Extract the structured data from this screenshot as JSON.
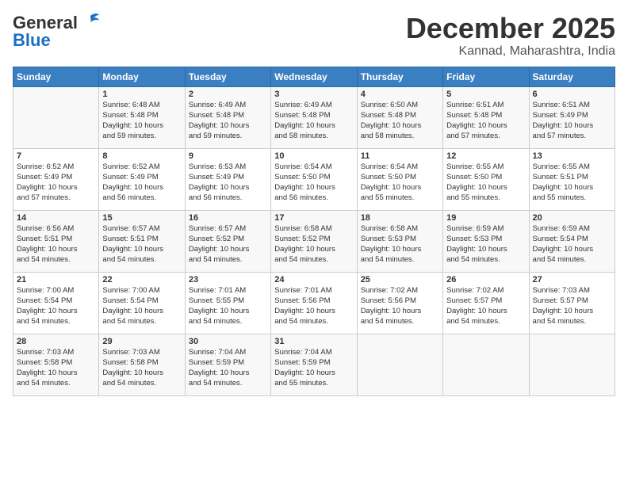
{
  "header": {
    "logo_line1": "General",
    "logo_line2": "Blue",
    "month": "December 2025",
    "location": "Kannad, Maharashtra, India"
  },
  "days_of_week": [
    "Sunday",
    "Monday",
    "Tuesday",
    "Wednesday",
    "Thursday",
    "Friday",
    "Saturday"
  ],
  "weeks": [
    [
      {
        "day": "",
        "info": ""
      },
      {
        "day": "1",
        "info": "Sunrise: 6:48 AM\nSunset: 5:48 PM\nDaylight: 10 hours\nand 59 minutes."
      },
      {
        "day": "2",
        "info": "Sunrise: 6:49 AM\nSunset: 5:48 PM\nDaylight: 10 hours\nand 59 minutes."
      },
      {
        "day": "3",
        "info": "Sunrise: 6:49 AM\nSunset: 5:48 PM\nDaylight: 10 hours\nand 58 minutes."
      },
      {
        "day": "4",
        "info": "Sunrise: 6:50 AM\nSunset: 5:48 PM\nDaylight: 10 hours\nand 58 minutes."
      },
      {
        "day": "5",
        "info": "Sunrise: 6:51 AM\nSunset: 5:48 PM\nDaylight: 10 hours\nand 57 minutes."
      },
      {
        "day": "6",
        "info": "Sunrise: 6:51 AM\nSunset: 5:49 PM\nDaylight: 10 hours\nand 57 minutes."
      }
    ],
    [
      {
        "day": "7",
        "info": "Sunrise: 6:52 AM\nSunset: 5:49 PM\nDaylight: 10 hours\nand 57 minutes."
      },
      {
        "day": "8",
        "info": "Sunrise: 6:52 AM\nSunset: 5:49 PM\nDaylight: 10 hours\nand 56 minutes."
      },
      {
        "day": "9",
        "info": "Sunrise: 6:53 AM\nSunset: 5:49 PM\nDaylight: 10 hours\nand 56 minutes."
      },
      {
        "day": "10",
        "info": "Sunrise: 6:54 AM\nSunset: 5:50 PM\nDaylight: 10 hours\nand 56 minutes."
      },
      {
        "day": "11",
        "info": "Sunrise: 6:54 AM\nSunset: 5:50 PM\nDaylight: 10 hours\nand 55 minutes."
      },
      {
        "day": "12",
        "info": "Sunrise: 6:55 AM\nSunset: 5:50 PM\nDaylight: 10 hours\nand 55 minutes."
      },
      {
        "day": "13",
        "info": "Sunrise: 6:55 AM\nSunset: 5:51 PM\nDaylight: 10 hours\nand 55 minutes."
      }
    ],
    [
      {
        "day": "14",
        "info": "Sunrise: 6:56 AM\nSunset: 5:51 PM\nDaylight: 10 hours\nand 54 minutes."
      },
      {
        "day": "15",
        "info": "Sunrise: 6:57 AM\nSunset: 5:51 PM\nDaylight: 10 hours\nand 54 minutes."
      },
      {
        "day": "16",
        "info": "Sunrise: 6:57 AM\nSunset: 5:52 PM\nDaylight: 10 hours\nand 54 minutes."
      },
      {
        "day": "17",
        "info": "Sunrise: 6:58 AM\nSunset: 5:52 PM\nDaylight: 10 hours\nand 54 minutes."
      },
      {
        "day": "18",
        "info": "Sunrise: 6:58 AM\nSunset: 5:53 PM\nDaylight: 10 hours\nand 54 minutes."
      },
      {
        "day": "19",
        "info": "Sunrise: 6:59 AM\nSunset: 5:53 PM\nDaylight: 10 hours\nand 54 minutes."
      },
      {
        "day": "20",
        "info": "Sunrise: 6:59 AM\nSunset: 5:54 PM\nDaylight: 10 hours\nand 54 minutes."
      }
    ],
    [
      {
        "day": "21",
        "info": "Sunrise: 7:00 AM\nSunset: 5:54 PM\nDaylight: 10 hours\nand 54 minutes."
      },
      {
        "day": "22",
        "info": "Sunrise: 7:00 AM\nSunset: 5:54 PM\nDaylight: 10 hours\nand 54 minutes."
      },
      {
        "day": "23",
        "info": "Sunrise: 7:01 AM\nSunset: 5:55 PM\nDaylight: 10 hours\nand 54 minutes."
      },
      {
        "day": "24",
        "info": "Sunrise: 7:01 AM\nSunset: 5:56 PM\nDaylight: 10 hours\nand 54 minutes."
      },
      {
        "day": "25",
        "info": "Sunrise: 7:02 AM\nSunset: 5:56 PM\nDaylight: 10 hours\nand 54 minutes."
      },
      {
        "day": "26",
        "info": "Sunrise: 7:02 AM\nSunset: 5:57 PM\nDaylight: 10 hours\nand 54 minutes."
      },
      {
        "day": "27",
        "info": "Sunrise: 7:03 AM\nSunset: 5:57 PM\nDaylight: 10 hours\nand 54 minutes."
      }
    ],
    [
      {
        "day": "28",
        "info": "Sunrise: 7:03 AM\nSunset: 5:58 PM\nDaylight: 10 hours\nand 54 minutes."
      },
      {
        "day": "29",
        "info": "Sunrise: 7:03 AM\nSunset: 5:58 PM\nDaylight: 10 hours\nand 54 minutes."
      },
      {
        "day": "30",
        "info": "Sunrise: 7:04 AM\nSunset: 5:59 PM\nDaylight: 10 hours\nand 54 minutes."
      },
      {
        "day": "31",
        "info": "Sunrise: 7:04 AM\nSunset: 5:59 PM\nDaylight: 10 hours\nand 55 minutes."
      },
      {
        "day": "",
        "info": ""
      },
      {
        "day": "",
        "info": ""
      },
      {
        "day": "",
        "info": ""
      }
    ]
  ]
}
